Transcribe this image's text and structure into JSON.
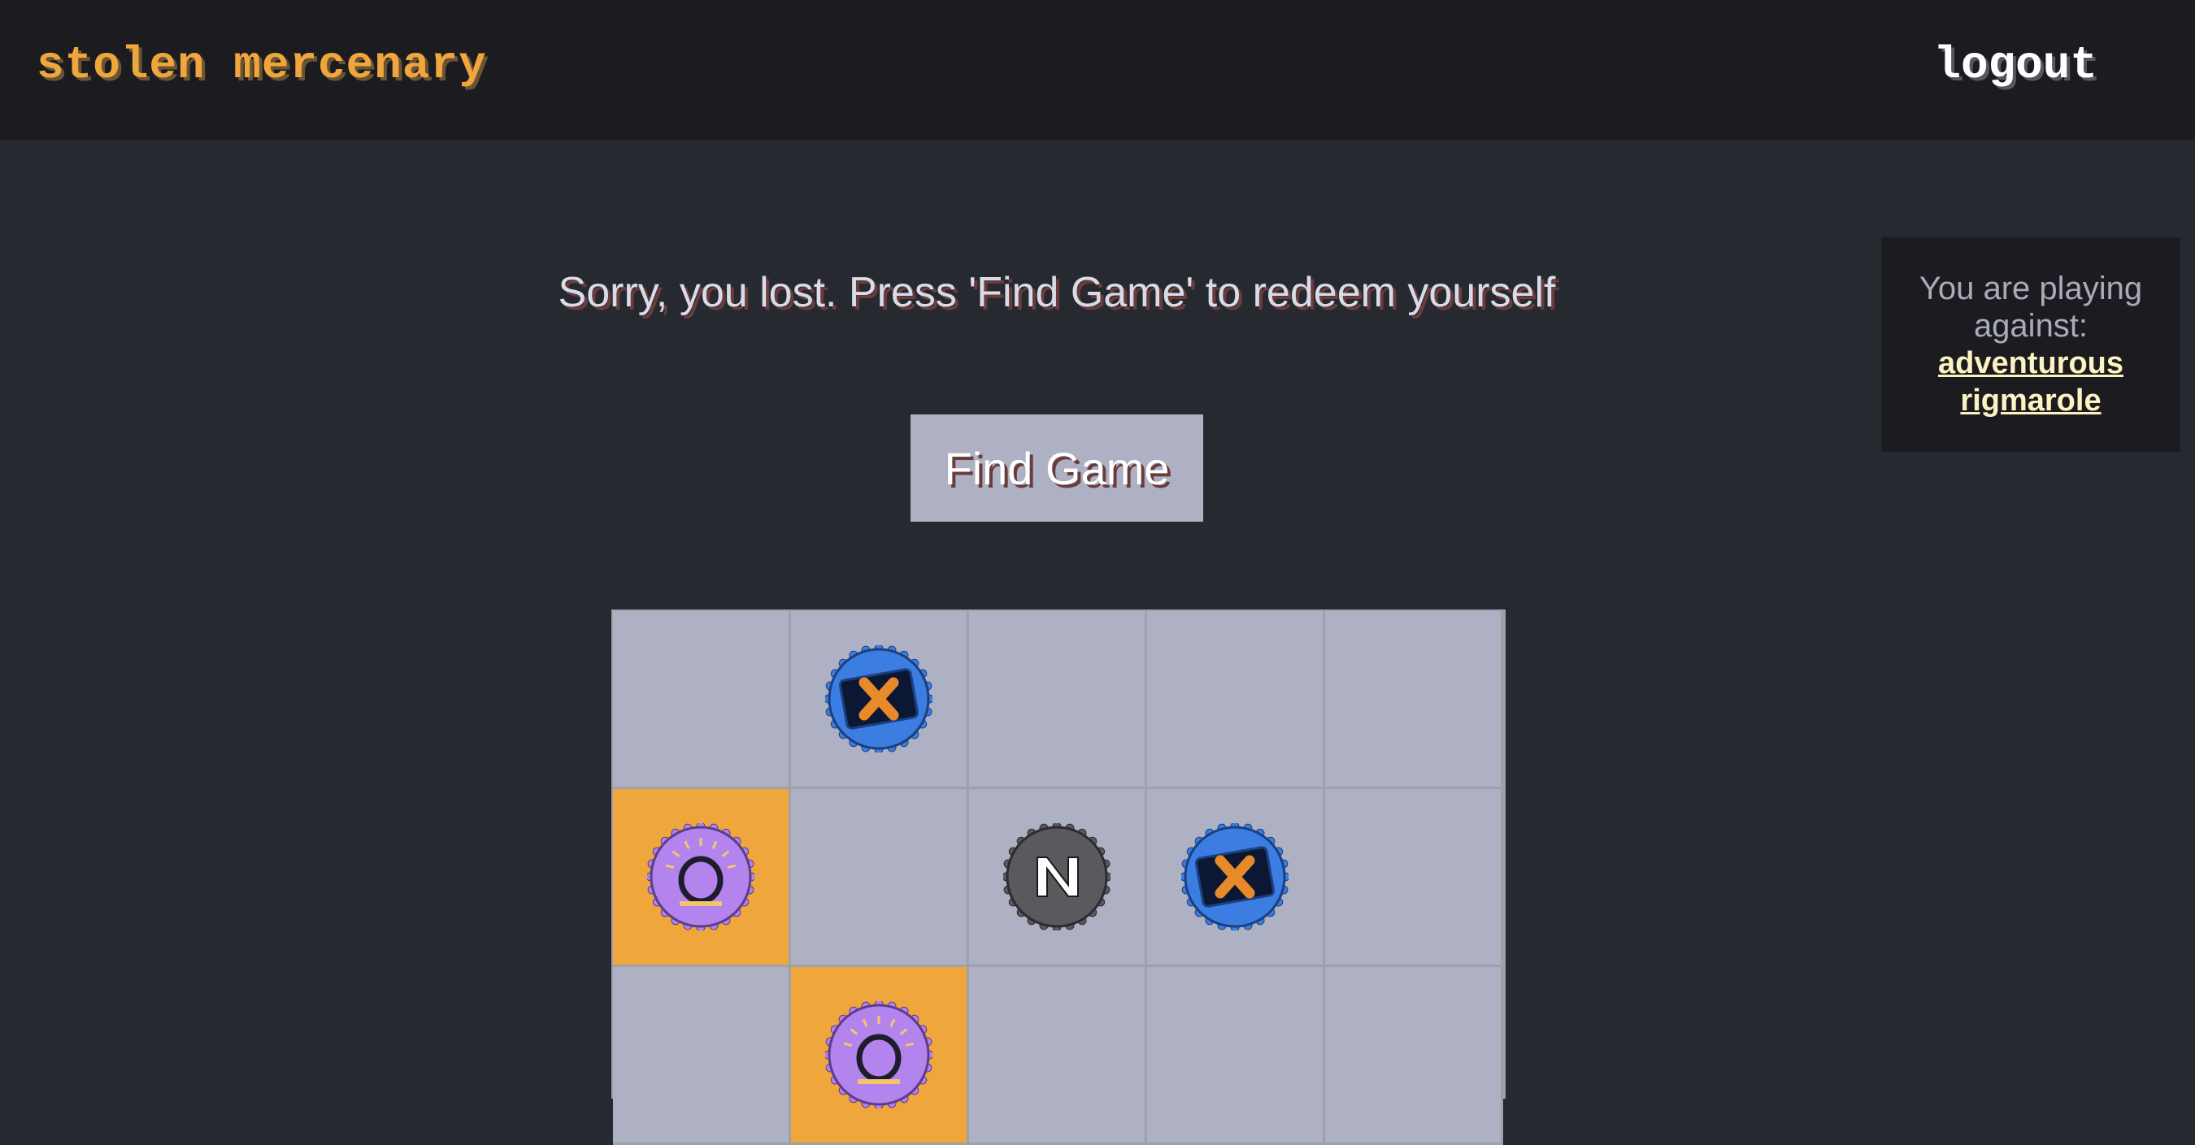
{
  "header": {
    "brand": "stolen mercenary",
    "logout_label": "logout"
  },
  "status": {
    "message": "Sorry, you lost. Press 'Find Game' to redeem yourself"
  },
  "actions": {
    "find_game_label": "Find Game"
  },
  "opponent": {
    "label": "You are playing against:",
    "name_line1": "adventurous",
    "name_line2": "rigmarole"
  },
  "board": {
    "columns": 5,
    "rows": [
      [
        {
          "piece": null,
          "highlight": false
        },
        {
          "piece": "X",
          "highlight": false
        },
        {
          "piece": null,
          "highlight": false
        },
        {
          "piece": null,
          "highlight": false
        },
        {
          "piece": null,
          "highlight": false
        }
      ],
      [
        {
          "piece": "O",
          "highlight": true
        },
        {
          "piece": null,
          "highlight": false
        },
        {
          "piece": "N",
          "highlight": false
        },
        {
          "piece": "X",
          "highlight": false
        },
        {
          "piece": null,
          "highlight": false
        }
      ],
      [
        {
          "piece": null,
          "highlight": false
        },
        {
          "piece": "O",
          "highlight": true
        },
        {
          "piece": null,
          "highlight": false
        },
        {
          "piece": null,
          "highlight": false
        },
        {
          "piece": null,
          "highlight": false
        }
      ]
    ]
  },
  "colors": {
    "accent": "#efa63d",
    "cell": "#aeb0c4",
    "x_cap": "#3b7de0",
    "o_cap": "#b383ee",
    "n_cap": "#5a5a5e"
  },
  "icons": {
    "X": "x-bottlecap-icon",
    "O": "o-bottlecap-icon",
    "N": "n-bottlecap-icon"
  }
}
